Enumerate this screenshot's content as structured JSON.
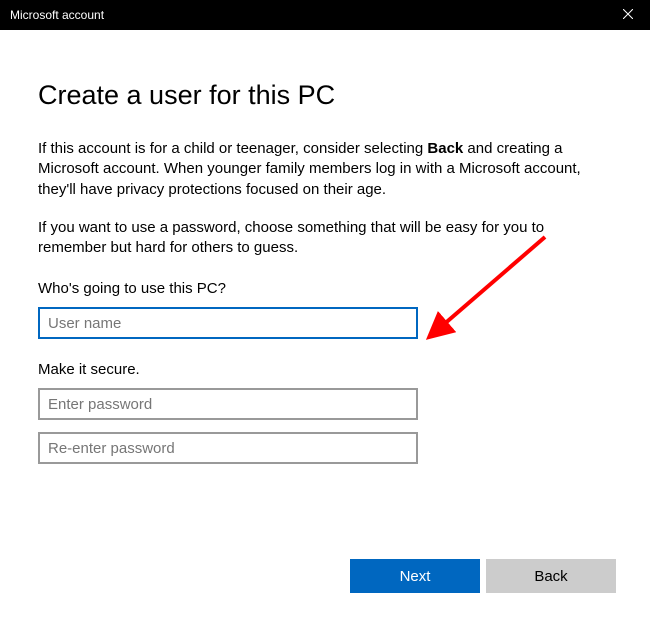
{
  "titlebar": {
    "title": "Microsoft account"
  },
  "page": {
    "title": "Create a user for this PC",
    "description1_prefix": "If this account is for a child or teenager, consider selecting ",
    "description1_bold": "Back",
    "description1_suffix": " and creating a Microsoft account. When younger family members log in with a Microsoft account, they'll have privacy protections focused on their age.",
    "description2": "If you want to use a password, choose something that will be easy for you to remember but hard for others to guess."
  },
  "section_user": {
    "label": "Who's going to use this PC?",
    "username_placeholder": "User name"
  },
  "section_secure": {
    "label": "Make it secure.",
    "password_placeholder": "Enter password",
    "confirm_placeholder": "Re-enter password"
  },
  "buttons": {
    "next": "Next",
    "back": "Back"
  }
}
